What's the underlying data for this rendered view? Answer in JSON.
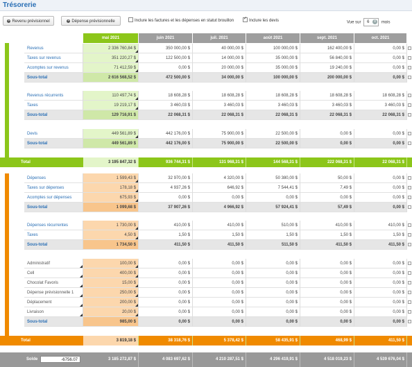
{
  "window": {
    "title": "Trésorerie"
  },
  "toolbar": {
    "revenu_btn": "Revenu prévisionnel",
    "depense_btn": "Dépense prévisionnelle",
    "include_drafts_label": "Inclure les factures et les dépenses en statut brouillon",
    "include_drafts_checked": false,
    "include_quotes_label": "Inclure les devis",
    "include_quotes_checked": true,
    "view_prefix": "Vue sur",
    "view_value": "6",
    "view_suffix": "mois"
  },
  "colors": {
    "revenue": "#8cc61a",
    "expense": "#f08a00",
    "header": "#9e9e9e",
    "link": "#2a6fb5"
  },
  "months": [
    "mai 2021",
    "juin 2021",
    "juil. 2021",
    "août 2021",
    "sept. 2021",
    "oct. 2021"
  ],
  "revenue_group1": [
    {
      "label": "Revenus",
      "values": [
        "2 336 760,84 $",
        "350 000,00 $",
        "40 000,00 $",
        "100 000,00 $",
        "162 400,00 $",
        "0,00 $"
      ]
    },
    {
      "label": "Taxes sur revenus",
      "values": [
        "351 220,27 $",
        "122 500,00 $",
        "14 000,00 $",
        "35 000,00 $",
        "56 840,00 $",
        "0,00 $"
      ]
    },
    {
      "label": "Acomptes sur revenus",
      "values": [
        "71 412,59 $",
        "0,00 $",
        "20 000,00 $",
        "35 000,00 $",
        "19 240,00 $",
        "0,00 $"
      ]
    },
    {
      "label": "Sous-total",
      "values": [
        "2 616 568,52 $",
        "472 500,00 $",
        "34 000,00 $",
        "100 000,00 $",
        "200 000,00 $",
        "0,00 $"
      ]
    }
  ],
  "revenue_group2": [
    {
      "label": "Revenus récurrents",
      "values": [
        "110 497,74 $",
        "18 608,28 $",
        "18 608,28 $",
        "18 608,28 $",
        "18 608,28 $",
        "18 608,28 $"
      ]
    },
    {
      "label": "Taxes",
      "values": [
        "19 219,17 $",
        "3 460,03 $",
        "3 460,03 $",
        "3 460,03 $",
        "3 460,03 $",
        "3 460,03 $"
      ]
    },
    {
      "label": "Sous-total",
      "values": [
        "129 716,91 $",
        "22 068,31 $",
        "22 068,31 $",
        "22 068,31 $",
        "22 068,31 $",
        "22 068,31 $"
      ]
    }
  ],
  "revenue_group3": [
    {
      "label": "Devis",
      "values": [
        "449 561,89 $",
        "442 176,00 $",
        "75 900,00 $",
        "22 500,00 $",
        "0,00 $",
        "0,00 $"
      ]
    },
    {
      "label": "Sous-total",
      "values": [
        "449 561,89 $",
        "442 176,00 $",
        "75 900,00 $",
        "22 500,00 $",
        "0,00 $",
        "0,00 $"
      ]
    }
  ],
  "revenue_total": {
    "label": "Total",
    "values": [
      "3 195 847,32 $",
      "936 744,31 $",
      "131 968,31 $",
      "144 568,31 $",
      "222 068,31 $",
      "22 068,31 $"
    ]
  },
  "expense_group1": [
    {
      "label": "Dépenses",
      "values": [
        "1 599,43 $",
        "32 970,00 $",
        "4 320,00 $",
        "50 380,00 $",
        "50,00 $",
        "0,00 $"
      ]
    },
    {
      "label": "Taxes sur dépenses",
      "values": [
        "178,18 $",
        "4 937,26 $",
        "646,92 $",
        "7 544,41 $",
        "7,49 $",
        "0,00 $"
      ]
    },
    {
      "label": "Acomptes sur dépenses",
      "values": [
        "675,93 $",
        "0,00 $",
        "0,00 $",
        "0,00 $",
        "0,00 $",
        "0,00 $"
      ]
    },
    {
      "label": "Sous-total",
      "values": [
        "1 099,68 $",
        "37 907,26 $",
        "4 966,92 $",
        "57 924,41 $",
        "57,49 $",
        "0,00 $"
      ]
    }
  ],
  "expense_group2": [
    {
      "label": "Dépenses récurrentes",
      "values": [
        "1 730,00 $",
        "410,00 $",
        "410,00 $",
        "510,00 $",
        "410,00 $",
        "410,00 $"
      ]
    },
    {
      "label": "Taxes",
      "values": [
        "4,50 $",
        "1,50 $",
        "1,50 $",
        "1,50 $",
        "1,50 $",
        "1,50 $"
      ]
    },
    {
      "label": "Sous-total",
      "values": [
        "1 734,50 $",
        "411,50 $",
        "411,50 $",
        "511,50 $",
        "411,50 $",
        "411,50 $"
      ]
    }
  ],
  "expense_group3": [
    {
      "label": "Administratif",
      "values": [
        "100,00 $",
        "0,00 $",
        "0,00 $",
        "0,00 $",
        "0,00 $",
        "0,00 $"
      ]
    },
    {
      "label": "Cell",
      "values": [
        "400,00 $",
        "0,00 $",
        "0,00 $",
        "0,00 $",
        "0,00 $",
        "0,00 $"
      ]
    },
    {
      "label": "Chocolat Favoris",
      "values": [
        "15,00 $",
        "0,00 $",
        "0,00 $",
        "0,00 $",
        "0,00 $",
        "0,00 $"
      ]
    },
    {
      "label": "Dépense prévisionnelle 1",
      "values": [
        "250,00 $",
        "0,00 $",
        "0,00 $",
        "0,00 $",
        "0,00 $",
        "0,00 $"
      ]
    },
    {
      "label": "Déplacement",
      "values": [
        "200,00 $",
        "0,00 $",
        "0,00 $",
        "0,00 $",
        "0,00 $",
        "0,00 $"
      ]
    },
    {
      "label": "Livraison",
      "values": [
        "20,00 $",
        "0,00 $",
        "0,00 $",
        "0,00 $",
        "0,00 $",
        "0,00 $"
      ]
    },
    {
      "label": "Sous-total",
      "values": [
        "985,00 $",
        "0,00 $",
        "0,00 $",
        "0,00 $",
        "0,00 $",
        "0,00 $"
      ]
    }
  ],
  "expense_total": {
    "label": "Total",
    "values": [
      "3 819,18 $",
      "38 318,76 $",
      "5 378,42 $",
      "58 435,91 $",
      "468,99 $",
      "411,50 $"
    ]
  },
  "solde": {
    "label": "Solde",
    "input_value": "-6756.07",
    "values": [
      "3 185 272,87 $",
      "4 083 697,62 $",
      "4 210 287,51 $",
      "4 296 419,91 $",
      "4 518 019,23 $",
      "4 539 676,04 $"
    ]
  }
}
